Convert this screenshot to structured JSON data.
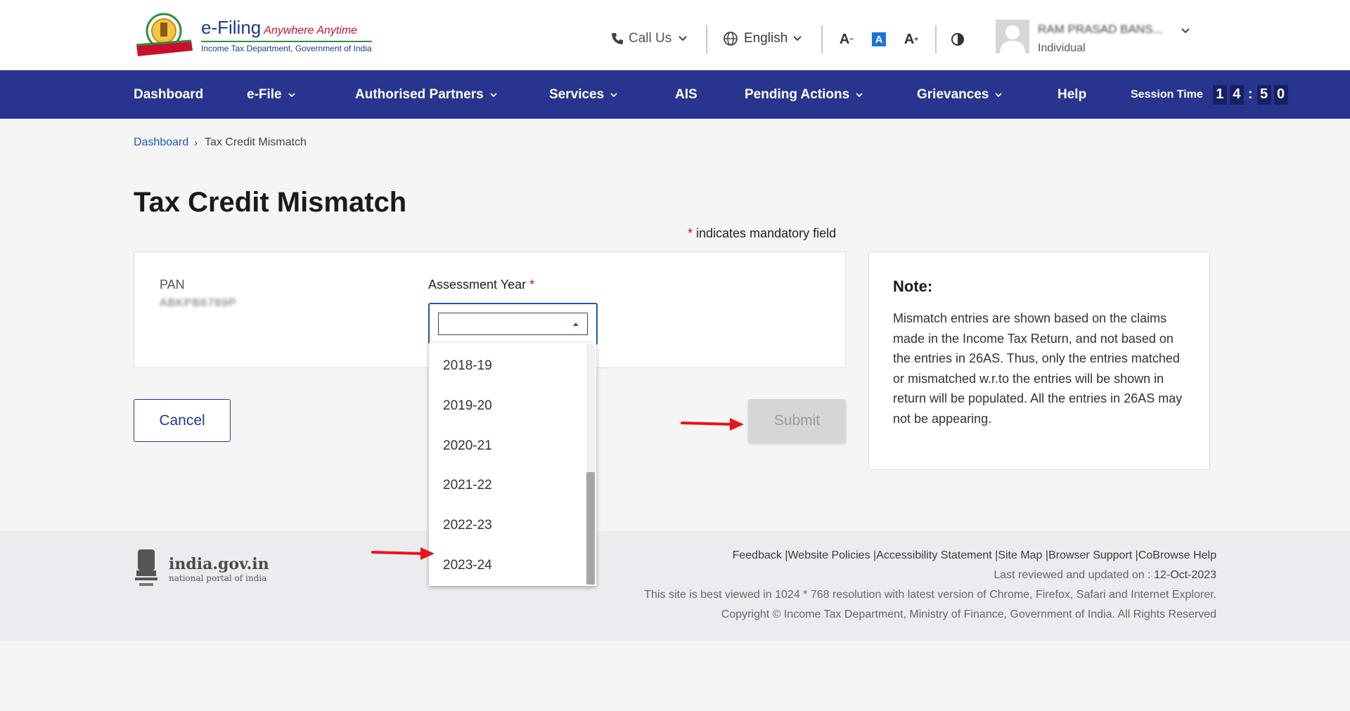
{
  "header": {
    "logo_title": "e-Filing",
    "logo_tagline": "Anywhere Anytime",
    "logo_subtitle": "Income Tax Department, Government of India",
    "call_us_label": "Call Us",
    "language_label": "English",
    "font_decrease": "A",
    "font_normal": "A",
    "font_increase": "A",
    "user_name": "RAM PRASAD BANS...",
    "user_role": "Individual"
  },
  "nav": {
    "items": [
      {
        "label": "Dashboard"
      },
      {
        "label": "e-File"
      },
      {
        "label": "Authorised Partners"
      },
      {
        "label": "Services"
      },
      {
        "label": "AIS"
      },
      {
        "label": "Pending Actions"
      },
      {
        "label": "Grievances"
      },
      {
        "label": "Help"
      }
    ],
    "session_label": "Session Time",
    "session_digits": [
      "1",
      "4",
      "5",
      "0"
    ],
    "session_separator": ":"
  },
  "breadcrumb": {
    "home": "Dashboard",
    "current": "Tax Credit Mismatch"
  },
  "page": {
    "title": "Tax Credit Mismatch",
    "mandatory_star": "*",
    "mandatory_text": " indicates mandatory field"
  },
  "form": {
    "pan_label": "PAN",
    "pan_value": "ABKPB6789P",
    "assessment_year_label": "Assessment Year",
    "assessment_year_value": "",
    "assessment_year_options": [
      "2018-19",
      "2019-20",
      "2020-21",
      "2021-22",
      "2022-23",
      "2023-24"
    ]
  },
  "buttons": {
    "cancel": "Cancel",
    "submit": "Submit"
  },
  "note": {
    "title": "Note:",
    "text": "Mismatch entries are shown based on the claims made in the Income Tax Return, and not based on the entries in 26AS. Thus, only the entries matched or mismatched w.r.to the entries will be shown in return will be populated. All the entries in 26AS may not be appearing."
  },
  "footer": {
    "gov_title": "india.gov.in",
    "gov_subtitle": "national portal of india",
    "links": [
      "Feedback",
      "Website Policies",
      "Accessibility Statement",
      "Site Map",
      "Browser Support",
      "CoBrowse Help"
    ],
    "last_reviewed_label": "Last reviewed and updated on : ",
    "last_reviewed_date": "12-Oct-2023",
    "best_viewed": "This site is best viewed in 1024 * 768 resolution with latest version of Chrome, Firefox, Safari and Internet Explorer.",
    "copyright": "Copyright © Income Tax Department, Ministry of Finance, Government of India. All Rights Reserved"
  },
  "colors": {
    "nav_bg": "#27358f",
    "link_blue": "#1e5bb0",
    "required_red": "#d0021b",
    "arrow_red": "#e8141c"
  }
}
